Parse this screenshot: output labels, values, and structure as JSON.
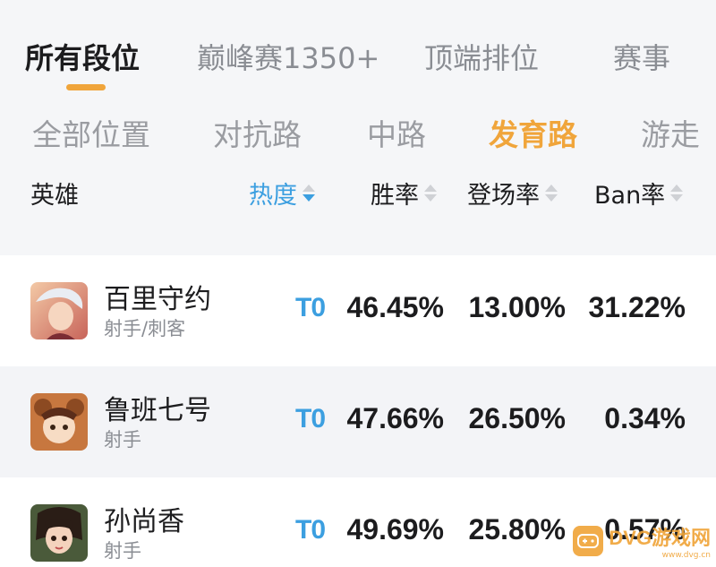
{
  "tier_tabs": [
    "所有段位",
    "巅峰赛1350+",
    "顶端排位",
    "赛事"
  ],
  "position_tabs": [
    "全部位置",
    "对抗路",
    "中路",
    "发育路",
    "游走"
  ],
  "headers": {
    "hero": "英雄",
    "popularity": "热度",
    "win_rate": "胜率",
    "pick_rate": "登场率",
    "ban_rate": "Ban率"
  },
  "heroes": [
    {
      "name": "百里守约",
      "role": "射手/刺客",
      "tier": "T0",
      "win_rate": "46.45%",
      "pick_rate": "13.00%",
      "ban_rate": "31.22%"
    },
    {
      "name": "鲁班七号",
      "role": "射手",
      "tier": "T0",
      "win_rate": "47.66%",
      "pick_rate": "26.50%",
      "ban_rate": "0.34%"
    },
    {
      "name": "孙尚香",
      "role": "射手",
      "tier": "T0",
      "win_rate": "49.69%",
      "pick_rate": "25.80%",
      "ban_rate": "0.57%"
    }
  ],
  "watermark": {
    "text": "DVG游戏网",
    "sub": "www.dvg.cn"
  },
  "colors": {
    "accent_orange": "#f0a53b",
    "accent_blue": "#3c9fe0"
  }
}
